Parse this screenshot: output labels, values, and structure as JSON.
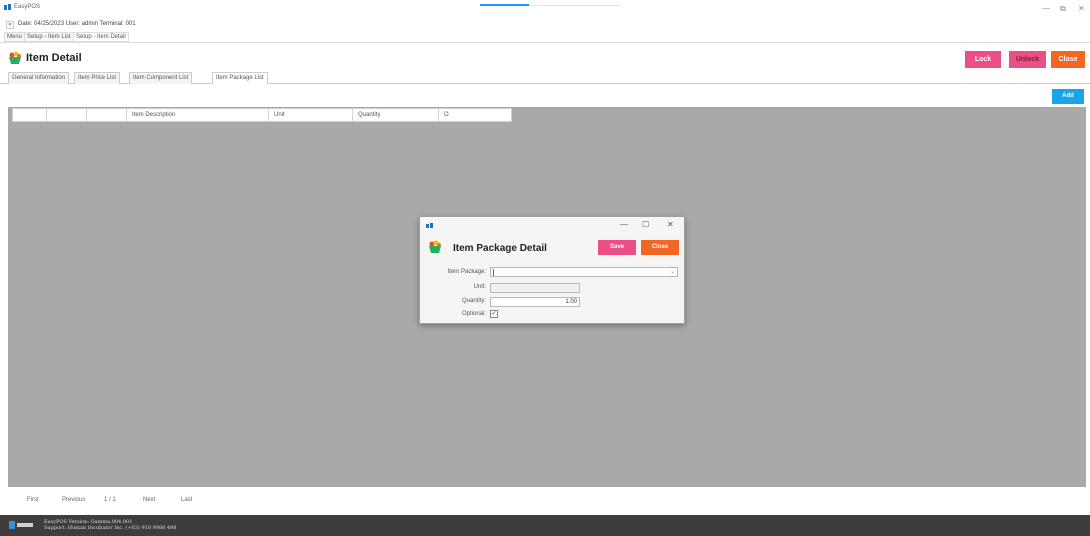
{
  "window": {
    "app_title": "EasyPOS",
    "progress": 0.35
  },
  "status": {
    "back_glyph": "«",
    "info": "Date: 04/25/2023   User: admin   Terminal: 001"
  },
  "breadcrumbs": [
    "Menu",
    "Setup - Item List",
    "Setup - Item Detail"
  ],
  "header": {
    "title": "Item Detail",
    "lock_label": "Lock",
    "unlock_label": "Unlock",
    "close_label": "Close"
  },
  "tabs": [
    "General Information",
    "Item Price List",
    "Item Component List",
    "Item Package List"
  ],
  "toolbar": {
    "add_label": "Add"
  },
  "grid": {
    "columns": [
      "",
      "",
      "",
      "Item Description",
      "Unit",
      "Quantity",
      "O"
    ]
  },
  "pager": {
    "first": "First",
    "previous": "Previous",
    "page": "1 / 1",
    "next": "Next",
    "last": "Last"
  },
  "footer": {
    "version": "EasyPOS Version: Gamma.004.001",
    "support": "Support: Human Incubator Inc. (+63) 918 9988 498"
  },
  "dialog": {
    "title": "Item Package Detail",
    "save_label": "Save",
    "close_label": "Close",
    "item_package_label": "Item Package:",
    "item_package_value": "",
    "unit_label": "Unit:",
    "unit_value": "",
    "quantity_label": "Quantity:",
    "quantity_value": "1.00",
    "optional_label": "Optional:",
    "optional_checked": true
  },
  "colors": {
    "lock": "#ec4f87",
    "unlock": "#ec4f87",
    "close": "#f26522",
    "add": "#1aa3e8",
    "grid_bg": "#a9a9a9",
    "footer_bg": "#3d3d3d"
  }
}
